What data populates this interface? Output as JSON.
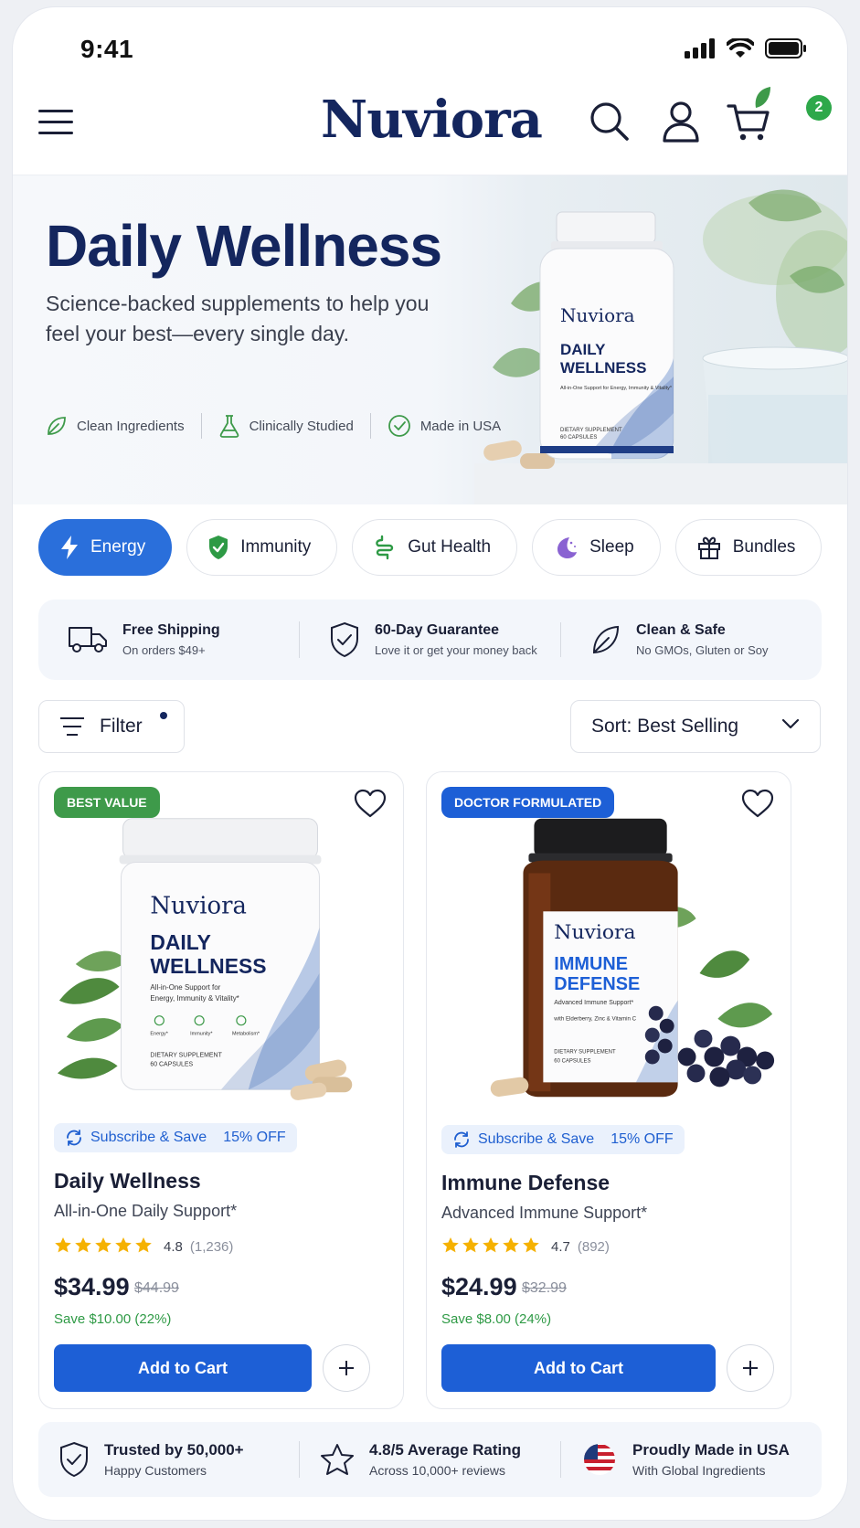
{
  "status": {
    "time": "9:41"
  },
  "header": {
    "logo": "Nuviora",
    "cart_count": "2"
  },
  "hero": {
    "title": "Daily Wellness",
    "subtitle": "Science-backed supplements to help you feel your best—every single day.",
    "badges": [
      "Clean Ingredients",
      "Clinically Studied",
      "Made in USA"
    ],
    "bottle": {
      "brand": "Nuviora",
      "line1": "DAILY",
      "line2": "WELLNESS",
      "tagline": "All-in-One Support for Energy, Immunity & Vitality*",
      "footer1": "DIETARY SUPPLEMENT",
      "footer2": "60 CAPSULES"
    }
  },
  "categories": [
    {
      "label": "Energy",
      "icon": "lightning-icon",
      "active": true
    },
    {
      "label": "Immunity",
      "icon": "shield-check-icon",
      "active": false
    },
    {
      "label": "Gut Health",
      "icon": "gut-icon",
      "active": false
    },
    {
      "label": "Sleep",
      "icon": "moon-icon",
      "active": false
    },
    {
      "label": "Bundles",
      "icon": "gift-icon",
      "active": false
    }
  ],
  "benefits": [
    {
      "title": "Free Shipping",
      "sub": "On orders $49+",
      "icon": "truck-icon"
    },
    {
      "title": "60-Day Guarantee",
      "sub": "Love it or get your money back",
      "icon": "shield-icon"
    },
    {
      "title": "Clean & Safe",
      "sub": "No GMOs, Gluten or Soy",
      "icon": "leaf-icon"
    }
  ],
  "toolbar": {
    "filter_label": "Filter",
    "sort_label": "Sort: Best Selling"
  },
  "products": [
    {
      "tag": "BEST VALUE",
      "tag_color": "#3e9a4a",
      "label": {
        "brand": "Nuviora",
        "line1": "DAILY",
        "line2": "WELLNESS",
        "tagline1": "All-in-One Support for",
        "tagline2": "Energy, Immunity & Vitality*",
        "icons": [
          "Energy*",
          "Immunity*",
          "Metabolism*"
        ],
        "footer1": "DIETARY SUPPLEMENT",
        "footer2": "60 CAPSULES"
      },
      "subscribe": "Subscribe & Save",
      "discount": "15% OFF",
      "name": "Daily Wellness",
      "desc": "All-in-One Daily Support*",
      "rating": "4.8",
      "reviews": "(1,236)",
      "stars": 5,
      "price": "$34.99",
      "was": "$44.99",
      "save": "Save $10.00 (22%)",
      "cta": "Add to Cart"
    },
    {
      "tag": "DOCTOR FORMULATED",
      "tag_color": "#1d5fd6",
      "label": {
        "brand": "Nuviora",
        "line1": "IMMUNE",
        "line2": "DEFENSE",
        "tagline1": "Advanced Immune Support*",
        "tagline2": "with Elderberry, Zinc & Vitamin C",
        "footer1": "DIETARY SUPPLEMENT",
        "footer2": "60 CAPSULES"
      },
      "subscribe": "Subscribe & Save",
      "discount": "15% OFF",
      "name": "Immune Defense",
      "desc": "Advanced Immune Support*",
      "rating": "4.7",
      "reviews": "(892)",
      "stars": 5,
      "price": "$24.99",
      "was": "$32.99",
      "save": "Save $8.00 (24%)",
      "cta": "Add to Cart"
    }
  ],
  "trust": [
    {
      "title": "Trusted by 50,000+",
      "sub": "Happy Customers",
      "icon": "shield-icon"
    },
    {
      "title": "4.8/5 Average Rating",
      "sub": "Across 10,000+ reviews",
      "icon": "star-icon"
    },
    {
      "title": "Proudly Made in USA",
      "sub": "With Global Ingredients",
      "icon": "us-flag-icon"
    }
  ],
  "colors": {
    "brand_navy": "#14265e",
    "accent_blue": "#1d5fd6",
    "green": "#2e9a45",
    "star": "#f5b100"
  }
}
